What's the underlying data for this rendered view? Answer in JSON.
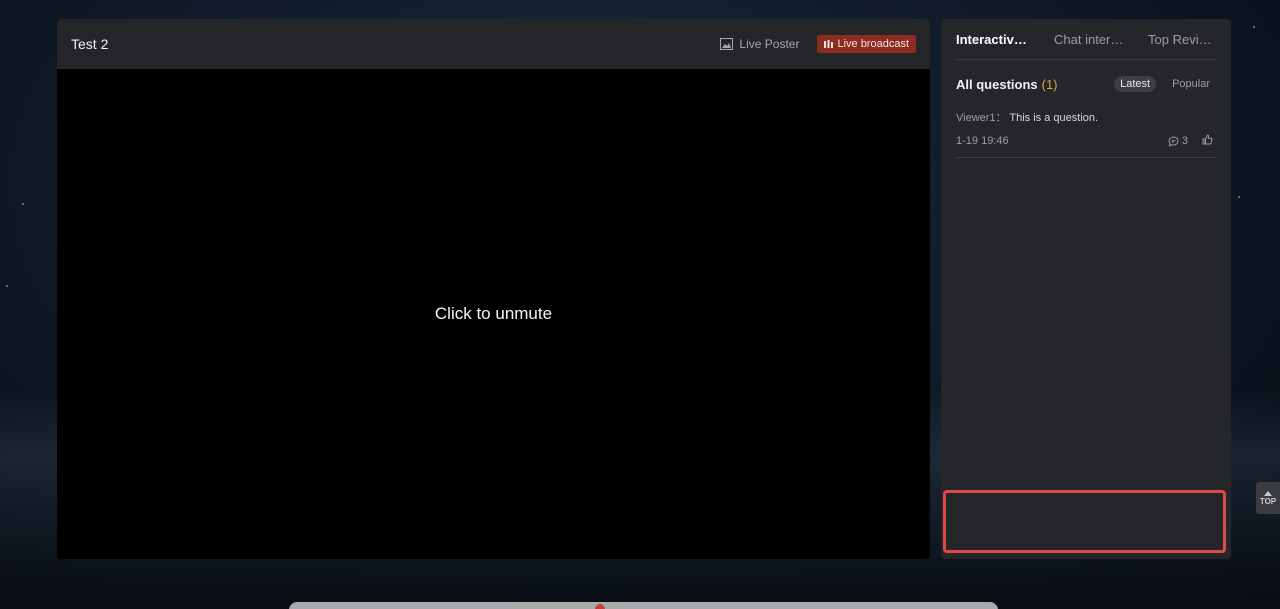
{
  "player": {
    "title": "Test 2",
    "live_poster_label": "Live Poster",
    "live_broadcast_label": "Live broadcast",
    "unmute_label": "Click to unmute"
  },
  "panel": {
    "tabs": [
      {
        "label": "Interactive Q&A"
      },
      {
        "label": "Chat interaction"
      },
      {
        "label": "Top Reviews"
      }
    ],
    "questions_title": "All questions",
    "questions_count": "(1)",
    "sort": {
      "latest": "Latest",
      "popular": "Popular"
    },
    "questions": [
      {
        "user": "Viewer1：",
        "text": "This is a question.",
        "time": "1-19 19:46",
        "replies": "3"
      }
    ]
  },
  "top_button": {
    "label": "TOP"
  },
  "colors": {
    "accent": "#8b2c1f",
    "highlight": "#e04949",
    "count": "#e3a64b"
  },
  "icons": {
    "poster": "image-icon",
    "broadcast": "bar-chart-icon",
    "reply": "comment-icon",
    "like": "thumbs-up-icon",
    "top": "arrow-up-icon"
  }
}
